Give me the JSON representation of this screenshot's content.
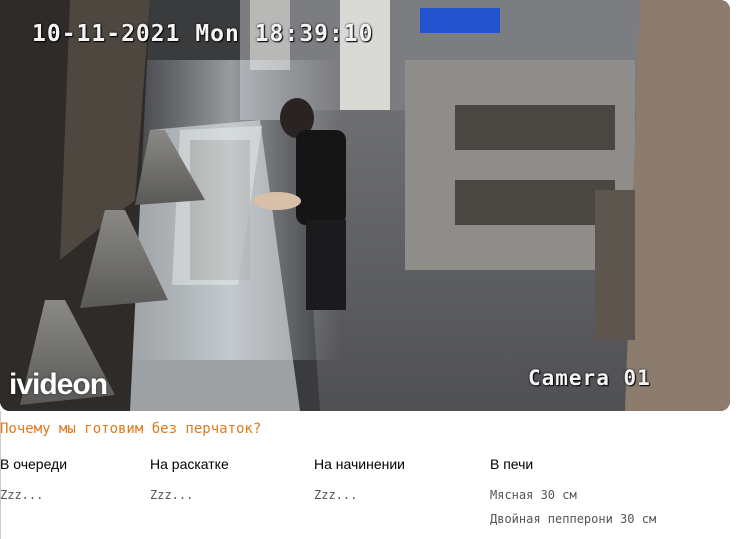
{
  "video": {
    "timestamp": "10-11-2021 Mon 18:39:10",
    "camera_label": "Camera 01",
    "logo_text": "ivideon"
  },
  "question": "Почему мы готовим без перчаток?",
  "columns": [
    {
      "header": "В очереди",
      "items": [
        "Zzz..."
      ]
    },
    {
      "header": "На раскатке",
      "items": [
        "Zzz..."
      ]
    },
    {
      "header": "На начинении",
      "items": [
        "Zzz..."
      ]
    },
    {
      "header": "В печи",
      "items": [
        "Мясная 30 см",
        "Двойная пепперони 30 см"
      ]
    }
  ],
  "colors": {
    "accent": "#e07a1c",
    "queue_text": "#555555"
  }
}
